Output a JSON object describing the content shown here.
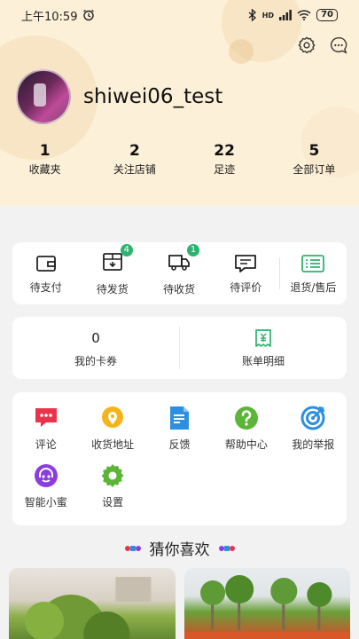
{
  "status_bar": {
    "time": "上午10:59",
    "signal": "HD",
    "battery": "70"
  },
  "profile": {
    "username": "shiwei06_test"
  },
  "stats": [
    {
      "num": "1",
      "label": "收藏夹"
    },
    {
      "num": "2",
      "label": "关注店铺"
    },
    {
      "num": "22",
      "label": "足迹"
    },
    {
      "num": "5",
      "label": "全部订单"
    }
  ],
  "orders": [
    {
      "label": "待支付",
      "icon": "wallet-icon",
      "badge": ""
    },
    {
      "label": "待发货",
      "icon": "package-icon",
      "badge": "4"
    },
    {
      "label": "待收货",
      "icon": "truck-icon",
      "badge": "1"
    },
    {
      "label": "待评价",
      "icon": "comment-icon",
      "badge": ""
    },
    {
      "label": "退货/售后",
      "icon": "return-icon",
      "badge": ""
    }
  ],
  "wallet": {
    "coupon_value": "0",
    "coupon_label": "我的卡券",
    "bill_label": "账单明细"
  },
  "services": [
    {
      "label": "评论",
      "icon": "chat-icon"
    },
    {
      "label": "收货地址",
      "icon": "location-icon"
    },
    {
      "label": "反馈",
      "icon": "feedback-icon"
    },
    {
      "label": "帮助中心",
      "icon": "help-icon"
    },
    {
      "label": "我的举报",
      "icon": "report-icon"
    },
    {
      "label": "智能小蜜",
      "icon": "assistant-icon"
    },
    {
      "label": "设置",
      "icon": "gear-icon"
    }
  ],
  "guess": {
    "title": "猜你喜欢"
  },
  "colors": {
    "header_bg": "#fdf0d8",
    "accent_green": "#2db36f",
    "page_bg": "#f2f2f2"
  }
}
